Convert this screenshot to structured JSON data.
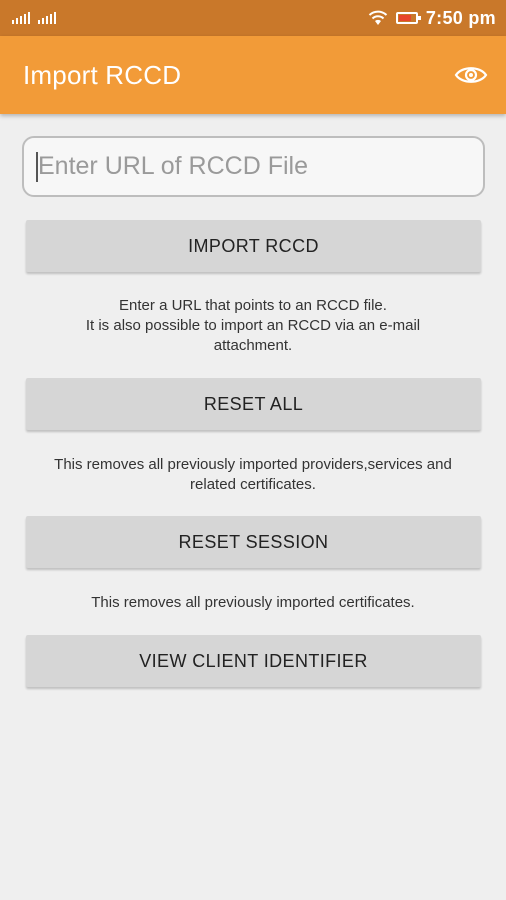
{
  "status_bar": {
    "time": "7:50 pm",
    "icons": [
      "signal-icon",
      "signal-icon",
      "wifi-icon",
      "battery-icon"
    ]
  },
  "app_bar": {
    "title": "Import RCCD",
    "action_icon": "eye-icon"
  },
  "url_input": {
    "placeholder": "Enter URL of RCCD File",
    "value": ""
  },
  "buttons": {
    "import": "IMPORT RCCD",
    "reset_all": "RESET ALL",
    "reset_session": "RESET SESSION",
    "view_client_id": "VIEW CLIENT IDENTIFIER"
  },
  "descriptions": {
    "import_line1": "Enter a URL that points to an RCCD file.",
    "import_line2": "It is also possible to import an RCCD via an e-mail",
    "import_line3": "attachment.",
    "reset_all_line1": "This removes all previously imported providers,services and",
    "reset_all_line2": "related certificates.",
    "reset_session": "This removes all previously imported certificates."
  },
  "colors": {
    "app_bar": "#f29b38",
    "status_bar": "#c9782a",
    "button": "#d6d6d6",
    "background": "#efefef"
  }
}
